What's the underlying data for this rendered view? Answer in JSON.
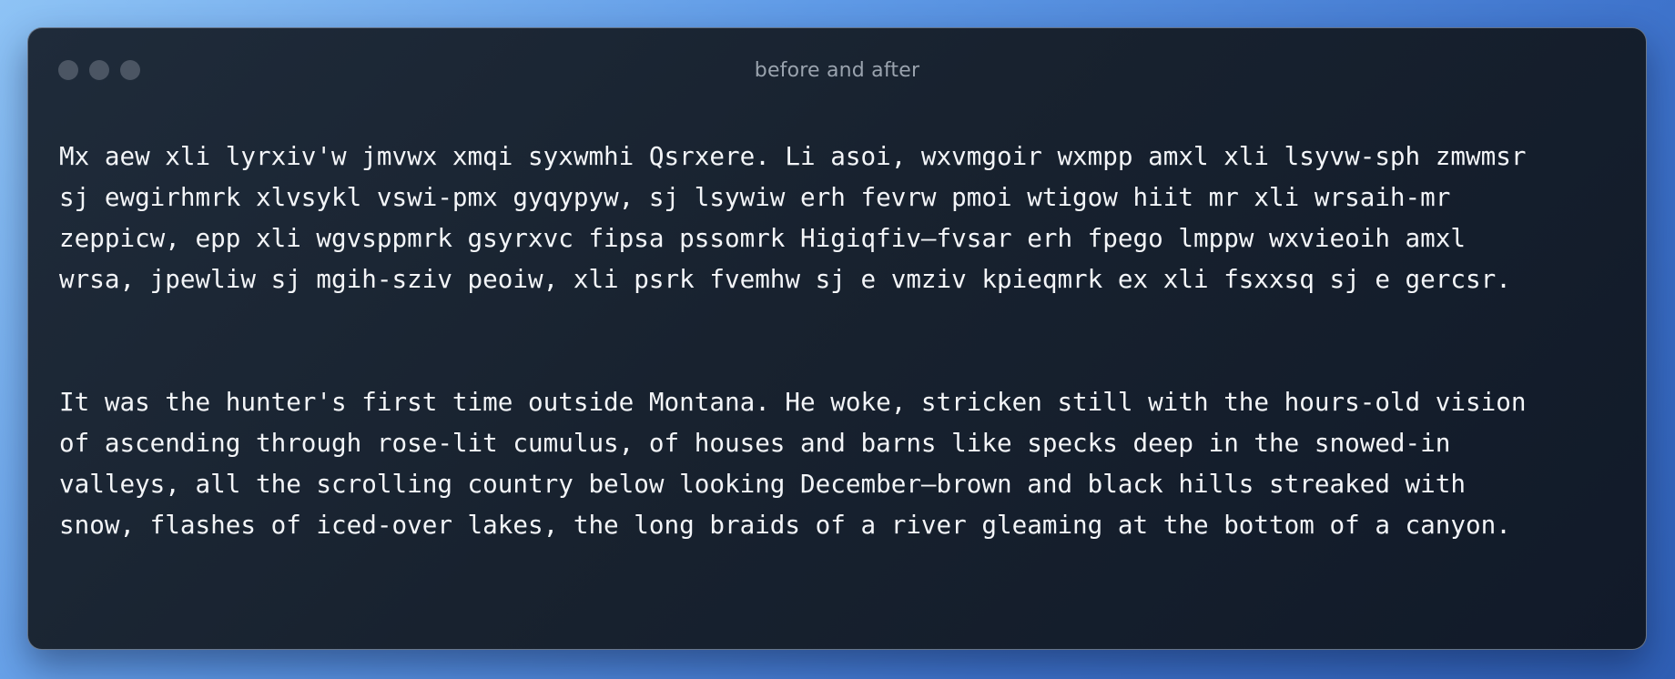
{
  "window": {
    "title": "before and after",
    "controls": [
      "close-dot",
      "minimize-dot",
      "maximize-dot"
    ]
  },
  "content": {
    "paragraphs": [
      "Mx aew xli lyrxiv'w jmvwx xmqi syxwmhi Qsrxere. Li asoi, wxvmgoir wxmpp amxl xli lsyvw-sph zmwmsr sj ewgirhmrk xlvsykl vswi-pmx gyqypyw, sj lsywiw erh fevrw pmoi wtigow hiit mr xli wrsaih-mr zeppicw, epp xli wgvsppmrk gsyrxvc fipsa pssomrk Higiqfiv—fvsar erh fpego lmppw wxvieoih amxl wrsa, jpewliw sj mgih-sziv peoiw, xli psrk fvemhw sj e vmziv kpieqmrk ex xli fsxxsq sj e gercsr.",
      "It was the hunter's first time outside Montana. He woke, stricken still with the hours-old vision of ascending through rose-lit cumulus, of houses and barns like specks deep in the snowed-in valleys, all the scrolling country below looking December—brown and black hills streaked with snow, flashes of iced-over lakes, the long braids of a river gleaming at the bottom of a canyon."
    ]
  },
  "colors": {
    "background_gradient_start": "#8ec3f5",
    "background_gradient_end": "#2f5fb5",
    "window_background": "#1a2431",
    "text": "#f3f5f8",
    "title_text": "#9aa3ae",
    "window_dots": "#4b5563"
  }
}
